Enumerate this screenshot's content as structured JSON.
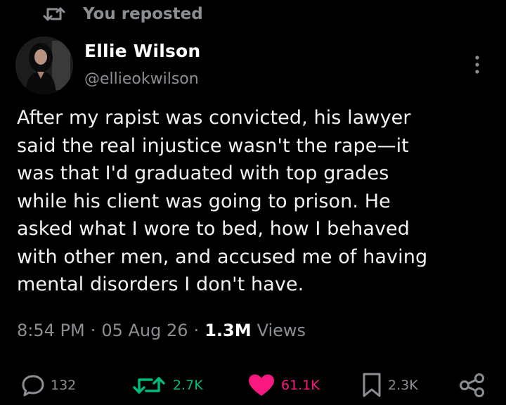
{
  "repost_banner": {
    "label": "You reposted",
    "icon": "repost-icon"
  },
  "author": {
    "name": "Ellie Wilson",
    "handle": "@ellieokwilson",
    "avatar_icon": "avatar"
  },
  "post": {
    "text": "After my rapist was convicted, his lawyer\nsaid the real injustice wasn't the rape—it\nwas that I'd graduated with top grades\nwhile his client was going to prison. He\nasked what I wore to bed, how I behaved\nwith other men, and accused me of having\nmental disorders I don't have."
  },
  "meta": {
    "time": "8:54 PM",
    "separator": "·",
    "date": "05 Aug 26",
    "views_count": "1.3M",
    "views_label": "Views"
  },
  "actions": {
    "reply": {
      "count": "132",
      "icon": "reply-icon"
    },
    "repost": {
      "count": "2.7K",
      "icon": "repost-icon",
      "color": "#00ba7c"
    },
    "like": {
      "count": "61.1K",
      "icon": "heart-icon",
      "color": "#f91880"
    },
    "bookmark": {
      "count": "2.3K",
      "icon": "bookmark-icon"
    },
    "share": {
      "icon": "share-icon"
    }
  },
  "colors": {
    "background": "#000000",
    "text": "#e7e9ea",
    "muted": "#8b8f94",
    "repost_green": "#00ba7c",
    "like_pink": "#f91880"
  }
}
